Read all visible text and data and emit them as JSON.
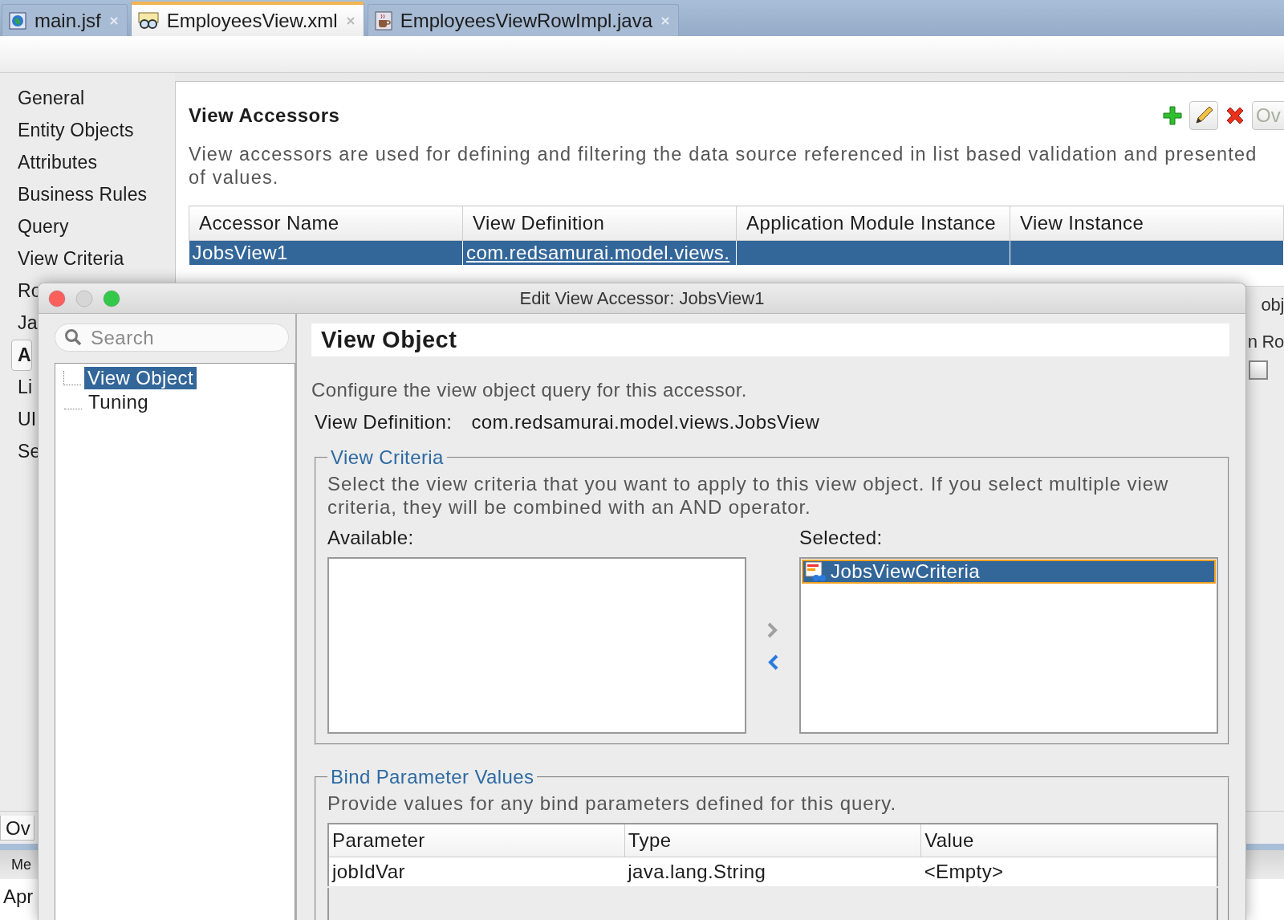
{
  "editor_tabs": [
    {
      "label": "main.jsf",
      "selected": false,
      "kind": "jsf"
    },
    {
      "label": "EmployeesView.xml",
      "selected": true,
      "kind": "xml"
    },
    {
      "label": "EmployeesViewRowImpl.java",
      "selected": false,
      "kind": "java"
    }
  ],
  "nav": {
    "items": [
      {
        "label": "General",
        "selected": false
      },
      {
        "label": "Entity Objects",
        "selected": false
      },
      {
        "label": "Attributes",
        "selected": false
      },
      {
        "label": "Business Rules",
        "selected": false
      },
      {
        "label": "Query",
        "selected": false
      },
      {
        "label": "View Criteria",
        "selected": false
      },
      {
        "label": "Ro",
        "selected": false
      },
      {
        "label": "Ja",
        "selected": false
      },
      {
        "label": "A",
        "selected": true
      },
      {
        "label": "Li",
        "selected": false
      },
      {
        "label": "UI",
        "selected": false
      },
      {
        "label": "Se",
        "selected": false
      }
    ]
  },
  "view_accessors": {
    "title": "View Accessors",
    "toolbar": [
      {
        "kind": "add"
      },
      {
        "kind": "edit"
      },
      {
        "kind": "delete"
      },
      {
        "kind": "text",
        "label": "Ov",
        "disabled": true
      }
    ],
    "description": "View accessors are used for defining and filtering the data source referenced in list based validation and presented of values.",
    "table": {
      "columns": [
        "Accessor Name",
        "View Definition",
        "Application Module Instance",
        "View Instance"
      ],
      "rows": [
        {
          "cells": [
            "JobsView1",
            "com.redsamurai.model.views."
          ],
          "selected": true
        }
      ]
    },
    "behind_dialog": {
      "texts": [
        "obj",
        "n Ro"
      ],
      "checkbox": {
        "checked": false
      }
    }
  },
  "bottom": {
    "editor_tab": "Ov",
    "log_tab": "Me",
    "log_text": "Apr"
  },
  "dialog": {
    "title": "Edit View Accessor: JobsView1",
    "search": {
      "placeholder": "Search"
    },
    "tree": [
      {
        "label": "View Object",
        "selected": true
      },
      {
        "label": "Tuning",
        "selected": false
      }
    ],
    "heading": "View Object",
    "intro": "Configure the view object query for this accessor.",
    "view_definition": {
      "label": "View Definition:",
      "value": "com.redsamurai.model.views.JobsView"
    },
    "view_criteria": {
      "legend": "View Criteria",
      "description": "Select the view criteria that you want to apply to this view object. If you select multiple view criteria, they will be combined with an AND operator.",
      "available_label": "Available:",
      "selected_label": "Selected:",
      "selected_items": [
        {
          "label": "JobsViewCriteria",
          "selected": true
        }
      ],
      "move_buttons": [
        {
          "kind": "add",
          "disabled": true
        },
        {
          "kind": "remove",
          "disabled": false
        }
      ]
    },
    "bind_parameters": {
      "legend": "Bind Parameter Values",
      "description": "Provide values for any bind parameters defined for this query.",
      "columns": [
        "Parameter",
        "Type",
        "Value"
      ],
      "rows": [
        [
          "jobIdVar",
          "java.lang.String",
          "<Empty>"
        ]
      ]
    }
  }
}
